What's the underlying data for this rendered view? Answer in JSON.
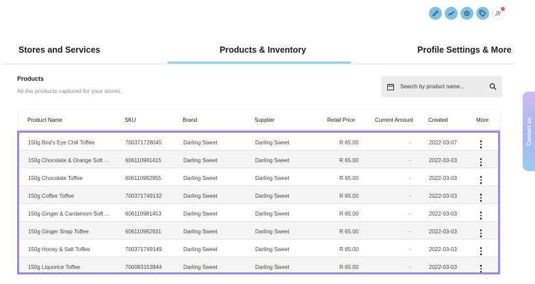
{
  "toolbar": {
    "icons": [
      "pencil-icon",
      "chart-trend-icon",
      "gear-icon",
      "tag-icon",
      "users-icon"
    ],
    "accent": "#7fc1e3",
    "notification_color": "#ef5a6f"
  },
  "tabs": [
    {
      "label": "Stores and Services",
      "active": false
    },
    {
      "label": "Products & Inventory",
      "active": true
    },
    {
      "label": "Profile Settings & More",
      "active": false
    }
  ],
  "section": {
    "title": "Products",
    "subtitle": "All the products captured for your stores."
  },
  "search": {
    "placeholder": "Search by product name...",
    "value": ""
  },
  "contact_tab": "Contact us",
  "table": {
    "columns": [
      "Product Name",
      "SKU",
      "Brand",
      "Supplier",
      "Retail Price",
      "Current Amount",
      "Created",
      "More"
    ],
    "rows": [
      {
        "name": "150g Bird's Eye Chili Toffee",
        "sku": "700371728045",
        "brand": "Darling Sweet",
        "supplier": "Darling Sweet",
        "price": "R  65.00",
        "current": "-",
        "created": "2022-03-07"
      },
      {
        "name": "150g Chocolate & Orange Soft C...",
        "sku": "606110981415",
        "brand": "Darling Sweet",
        "supplier": "Darling Sweet",
        "price": "R  65.00",
        "current": "-",
        "created": "2022-03-03"
      },
      {
        "name": "150g Chocolate Toffee",
        "sku": "606110982955",
        "brand": "Darling Sweet",
        "supplier": "Darling Sweet",
        "price": "R  65.00",
        "current": "-",
        "created": "2022-03-03"
      },
      {
        "name": "150g Coffee Toffee",
        "sku": "700371749132",
        "brand": "Darling Sweet",
        "supplier": "Darling Sweet",
        "price": "R  65.00",
        "current": "-",
        "created": "2022-03-03"
      },
      {
        "name": "150g Ginger & Cardamom Soft Ca...",
        "sku": "606110981453",
        "brand": "Darling Sweet",
        "supplier": "Darling Sweet",
        "price": "R  65.00",
        "current": "-",
        "created": "2022-03-03"
      },
      {
        "name": "150g Ginger Snap Toffee",
        "sku": "606110982931",
        "brand": "Darling Sweet",
        "supplier": "Darling Sweet",
        "price": "R  65.00",
        "current": "-",
        "created": "2022-03-03"
      },
      {
        "name": "150g Honey & Salt Toffee",
        "sku": "700371749149",
        "brand": "Darling Sweet",
        "supplier": "Darling Sweet",
        "price": "R  65.00",
        "current": "-",
        "created": "2022-03-03"
      },
      {
        "name": "150g Liquorice Toffee",
        "sku": "700083153944",
        "brand": "Darling Sweet",
        "supplier": "Darling Sweet",
        "price": "R  65.00",
        "current": "-",
        "created": "2022-03-03"
      }
    ]
  }
}
